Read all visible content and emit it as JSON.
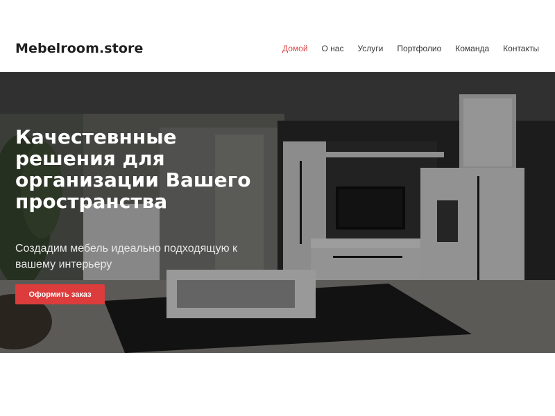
{
  "header": {
    "logo": "Mebelroom.store",
    "nav": [
      {
        "label": "Домой",
        "active": true
      },
      {
        "label": "О нас",
        "active": false
      },
      {
        "label": "Услуги",
        "active": false
      },
      {
        "label": "Портфолио",
        "active": false
      },
      {
        "label": "Команда",
        "active": false
      },
      {
        "label": "Контакты",
        "active": false
      }
    ]
  },
  "hero": {
    "title": "Качестевнные решения для организации Вашего пространства",
    "subtitle": "Создадим мебель идеально подходящую к вашему интерьеру",
    "cta_label": "Оформить заказ"
  },
  "colors": {
    "accent": "#dc3c3c",
    "nav_active": "#d94848",
    "text_dark": "#1f1f1f"
  }
}
